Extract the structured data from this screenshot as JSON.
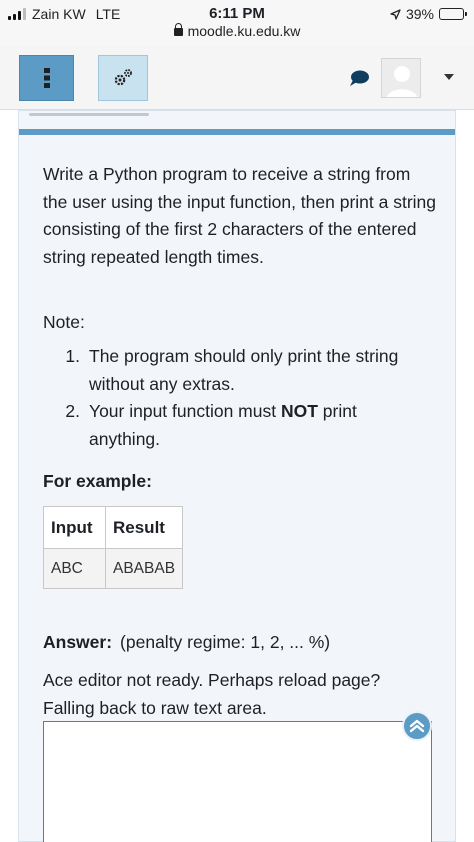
{
  "status_bar": {
    "carrier": "Zain KW",
    "network": "LTE",
    "time": "6:11 PM",
    "url": "moodle.ku.edu.kw",
    "battery": "39%",
    "battery_level": 0.39
  },
  "question": {
    "paragraph": "Write a Python program to receive a string from the user using the input function, then print a string consisting of the first 2 characters of the entered string repeated length times.",
    "note_label": "Note:",
    "list": [
      {
        "num": "1.",
        "text": "The program should only print the string without any extras."
      },
      {
        "num": "2.",
        "pre": "Your input function must ",
        "bold": "NOT",
        "post": " print anything."
      }
    ],
    "for_example": "For example:",
    "table": {
      "headers": [
        "Input",
        "Result"
      ],
      "rows": [
        [
          "ABC",
          "ABABAB"
        ]
      ]
    },
    "answer_label": "Answer:",
    "penalty": "(penalty regime: 1, 2, ... %)",
    "ace_message": "Ace editor not ready. Perhaps reload page? Falling back to raw text area.",
    "textarea_value": ""
  },
  "colors": {
    "accent": "#5b9bc5",
    "card_bg": "#f2f6fa"
  }
}
